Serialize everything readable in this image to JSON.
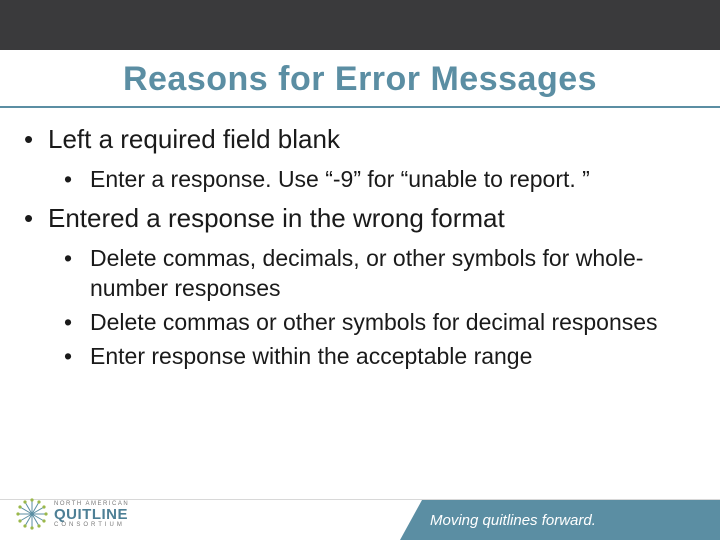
{
  "title": "Reasons for Error Messages",
  "bullets": [
    {
      "text": "Left a required field blank",
      "children": [
        "Enter a response. Use “-9” for “unable to report. ”"
      ]
    },
    {
      "text": "Entered a response in the wrong format",
      "children": [
        "Delete commas, decimals, or other symbols for whole-number responses",
        "Delete commas or other symbols for decimal responses",
        "Enter response within the acceptable range"
      ]
    }
  ],
  "logo": {
    "top": "NORTH AMERICAN",
    "main": "QUITLINE",
    "sub": "CONSORTIUM"
  },
  "tagline": "Moving quitlines forward."
}
